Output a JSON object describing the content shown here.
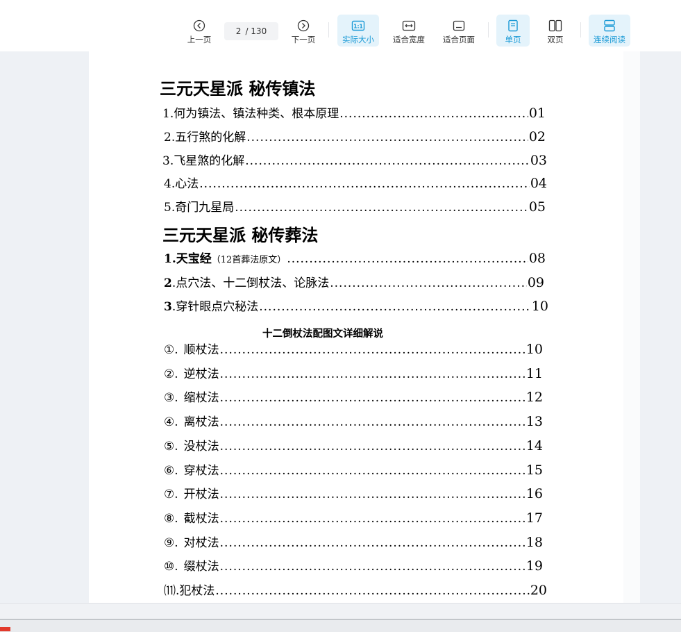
{
  "toolbar": {
    "prev_label": "上一页",
    "next_label": "下一页",
    "page_current": "2",
    "page_total": "/ 130",
    "actual_size_label": "实际大小",
    "fit_width_label": "适合宽度",
    "fit_page_label": "适合页面",
    "single_page_label": "单页",
    "double_page_label": "双页",
    "continuous_label": "连续阅读",
    "accent_color": "#1a9ad6"
  },
  "document": {
    "section1_title": "三元天星派 秘传镇法",
    "section1_items": [
      {
        "label": "1.何为镇法、镇法种类、根本原理",
        "page": "01"
      },
      {
        "label": "2.五行煞的化解",
        "page": "02"
      },
      {
        "label": "3.飞星煞的化解",
        "page": "03"
      },
      {
        "label": "4.心法",
        "page": "04"
      },
      {
        "label": "5.奇门九星局",
        "page": "05"
      }
    ],
    "section2_title": "三元天星派 秘传葬法",
    "section2_items": [
      {
        "num": "1",
        "label": ".天宝经",
        "note": "（12首葬法原文）",
        "page": "08"
      },
      {
        "num": "2",
        "label": ".点穴法、十二倒杖法、论脉法",
        "note": "",
        "page": "09"
      },
      {
        "num": "3",
        "label": ".穿针眼点穴秘法",
        "note": "",
        "page": "10"
      }
    ],
    "subsection_title": "十二倒杖法配图文详细解说",
    "staff_items": [
      {
        "mark": "①.",
        "label": "顺杖法",
        "page": "10"
      },
      {
        "mark": "②.",
        "label": "逆杖法",
        "page": "11"
      },
      {
        "mark": "③.",
        "label": "缩杖法",
        "page": "12"
      },
      {
        "mark": "④.",
        "label": "离杖法",
        "page": "13"
      },
      {
        "mark": "⑤.",
        "label": "没杖法",
        "page": "14"
      },
      {
        "mark": "⑥.",
        "label": "穿杖法",
        "page": "15"
      },
      {
        "mark": "⑦.",
        "label": "开杖法",
        "page": "16"
      },
      {
        "mark": "⑧.",
        "label": "截杖法",
        "page": "17"
      },
      {
        "mark": "⑨.",
        "label": "对杖法",
        "page": "18"
      },
      {
        "mark": "⑩.",
        "label": "缀杖法",
        "page": "19"
      },
      {
        "mark": "⑾.",
        "label": "犯杖法",
        "page": "20"
      }
    ]
  }
}
